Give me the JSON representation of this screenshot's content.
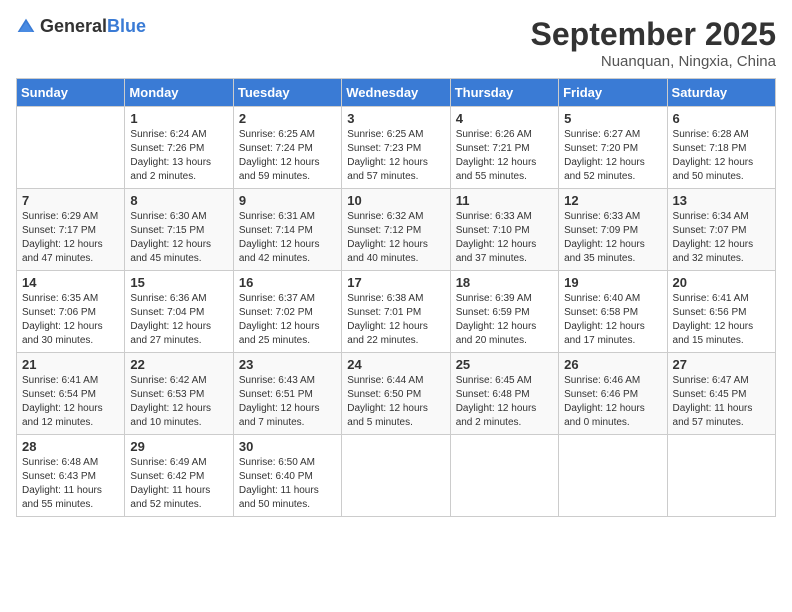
{
  "header": {
    "logo_general": "General",
    "logo_blue": "Blue",
    "month": "September 2025",
    "location": "Nuanquan, Ningxia, China"
  },
  "days_of_week": [
    "Sunday",
    "Monday",
    "Tuesday",
    "Wednesday",
    "Thursday",
    "Friday",
    "Saturday"
  ],
  "weeks": [
    [
      {
        "day": "",
        "info": ""
      },
      {
        "day": "1",
        "info": "Sunrise: 6:24 AM\nSunset: 7:26 PM\nDaylight: 13 hours\nand 2 minutes."
      },
      {
        "day": "2",
        "info": "Sunrise: 6:25 AM\nSunset: 7:24 PM\nDaylight: 12 hours\nand 59 minutes."
      },
      {
        "day": "3",
        "info": "Sunrise: 6:25 AM\nSunset: 7:23 PM\nDaylight: 12 hours\nand 57 minutes."
      },
      {
        "day": "4",
        "info": "Sunrise: 6:26 AM\nSunset: 7:21 PM\nDaylight: 12 hours\nand 55 minutes."
      },
      {
        "day": "5",
        "info": "Sunrise: 6:27 AM\nSunset: 7:20 PM\nDaylight: 12 hours\nand 52 minutes."
      },
      {
        "day": "6",
        "info": "Sunrise: 6:28 AM\nSunset: 7:18 PM\nDaylight: 12 hours\nand 50 minutes."
      }
    ],
    [
      {
        "day": "7",
        "info": "Sunrise: 6:29 AM\nSunset: 7:17 PM\nDaylight: 12 hours\nand 47 minutes."
      },
      {
        "day": "8",
        "info": "Sunrise: 6:30 AM\nSunset: 7:15 PM\nDaylight: 12 hours\nand 45 minutes."
      },
      {
        "day": "9",
        "info": "Sunrise: 6:31 AM\nSunset: 7:14 PM\nDaylight: 12 hours\nand 42 minutes."
      },
      {
        "day": "10",
        "info": "Sunrise: 6:32 AM\nSunset: 7:12 PM\nDaylight: 12 hours\nand 40 minutes."
      },
      {
        "day": "11",
        "info": "Sunrise: 6:33 AM\nSunset: 7:10 PM\nDaylight: 12 hours\nand 37 minutes."
      },
      {
        "day": "12",
        "info": "Sunrise: 6:33 AM\nSunset: 7:09 PM\nDaylight: 12 hours\nand 35 minutes."
      },
      {
        "day": "13",
        "info": "Sunrise: 6:34 AM\nSunset: 7:07 PM\nDaylight: 12 hours\nand 32 minutes."
      }
    ],
    [
      {
        "day": "14",
        "info": "Sunrise: 6:35 AM\nSunset: 7:06 PM\nDaylight: 12 hours\nand 30 minutes."
      },
      {
        "day": "15",
        "info": "Sunrise: 6:36 AM\nSunset: 7:04 PM\nDaylight: 12 hours\nand 27 minutes."
      },
      {
        "day": "16",
        "info": "Sunrise: 6:37 AM\nSunset: 7:02 PM\nDaylight: 12 hours\nand 25 minutes."
      },
      {
        "day": "17",
        "info": "Sunrise: 6:38 AM\nSunset: 7:01 PM\nDaylight: 12 hours\nand 22 minutes."
      },
      {
        "day": "18",
        "info": "Sunrise: 6:39 AM\nSunset: 6:59 PM\nDaylight: 12 hours\nand 20 minutes."
      },
      {
        "day": "19",
        "info": "Sunrise: 6:40 AM\nSunset: 6:58 PM\nDaylight: 12 hours\nand 17 minutes."
      },
      {
        "day": "20",
        "info": "Sunrise: 6:41 AM\nSunset: 6:56 PM\nDaylight: 12 hours\nand 15 minutes."
      }
    ],
    [
      {
        "day": "21",
        "info": "Sunrise: 6:41 AM\nSunset: 6:54 PM\nDaylight: 12 hours\nand 12 minutes."
      },
      {
        "day": "22",
        "info": "Sunrise: 6:42 AM\nSunset: 6:53 PM\nDaylight: 12 hours\nand 10 minutes."
      },
      {
        "day": "23",
        "info": "Sunrise: 6:43 AM\nSunset: 6:51 PM\nDaylight: 12 hours\nand 7 minutes."
      },
      {
        "day": "24",
        "info": "Sunrise: 6:44 AM\nSunset: 6:50 PM\nDaylight: 12 hours\nand 5 minutes."
      },
      {
        "day": "25",
        "info": "Sunrise: 6:45 AM\nSunset: 6:48 PM\nDaylight: 12 hours\nand 2 minutes."
      },
      {
        "day": "26",
        "info": "Sunrise: 6:46 AM\nSunset: 6:46 PM\nDaylight: 12 hours\nand 0 minutes."
      },
      {
        "day": "27",
        "info": "Sunrise: 6:47 AM\nSunset: 6:45 PM\nDaylight: 11 hours\nand 57 minutes."
      }
    ],
    [
      {
        "day": "28",
        "info": "Sunrise: 6:48 AM\nSunset: 6:43 PM\nDaylight: 11 hours\nand 55 minutes."
      },
      {
        "day": "29",
        "info": "Sunrise: 6:49 AM\nSunset: 6:42 PM\nDaylight: 11 hours\nand 52 minutes."
      },
      {
        "day": "30",
        "info": "Sunrise: 6:50 AM\nSunset: 6:40 PM\nDaylight: 11 hours\nand 50 minutes."
      },
      {
        "day": "",
        "info": ""
      },
      {
        "day": "",
        "info": ""
      },
      {
        "day": "",
        "info": ""
      },
      {
        "day": "",
        "info": ""
      }
    ]
  ]
}
